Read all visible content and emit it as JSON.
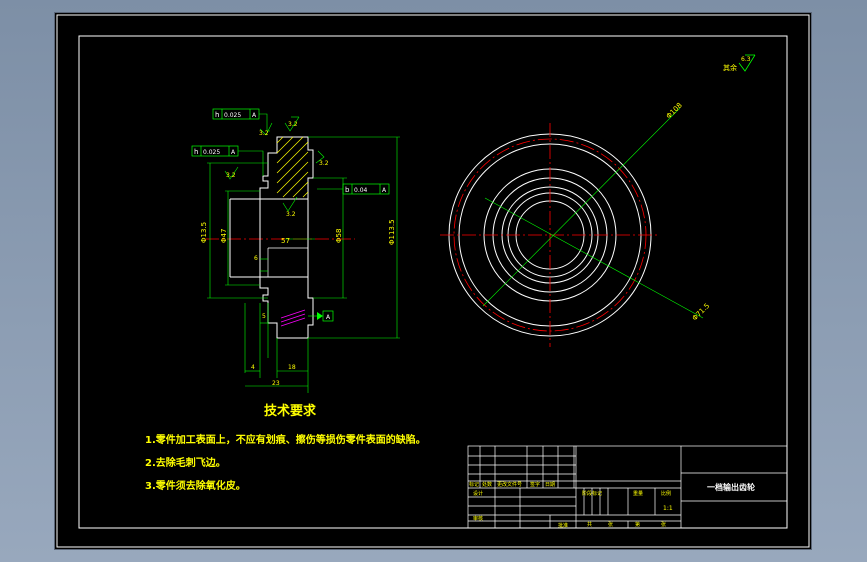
{
  "tech_req": {
    "title": "技术要求",
    "items": [
      "1.零件加工表面上，不应有划痕、擦伤等损伤零件表面的缺陷。",
      "2.去除毛刺飞边。",
      "3.零件须去除氧化皮。"
    ]
  },
  "roughness_other": {
    "label": "其余",
    "value": "6.3"
  },
  "section_view": {
    "tolerances": [
      {
        "symbol": "h",
        "value": "0.025",
        "datum": "A"
      },
      {
        "symbol": "h",
        "value": "0.025",
        "datum": "A"
      },
      {
        "symbol": "b",
        "value": "0.04",
        "datum": "A"
      }
    ],
    "roughness": [
      "3.2",
      "3.2",
      "3.2",
      "3.2",
      "3.2"
    ],
    "datum_flag": "A",
    "dims": {
      "d1": "Φ13.5",
      "d2": "Φ47",
      "d3": "57",
      "d4": "Φ58",
      "d5": "Φ113.5",
      "w1": "6",
      "w2": "5",
      "w3": "4",
      "w4": "18",
      "w5": "23"
    }
  },
  "front_view": {
    "dia_top": "Φ108",
    "dia_bottom": "Φ71.5"
  },
  "title_block": {
    "part_name": "一档输出齿轮",
    "scale": "1:1",
    "row_labels": [
      "标记",
      "处数",
      "更改文件号",
      "签字",
      "日期"
    ],
    "labels_design": [
      "设计",
      "审核",
      "批准"
    ],
    "labels_stage": [
      "阶段标记",
      "重量",
      "比例"
    ],
    "labels_sheet": [
      "共",
      "张",
      "第",
      "张"
    ]
  },
  "colors": {
    "frame": "#ffffff",
    "outline": "#ffffff",
    "dimension": "#00ff00",
    "center": "#ff0000",
    "hatch": "#ffff00",
    "text": "#ffff00"
  }
}
